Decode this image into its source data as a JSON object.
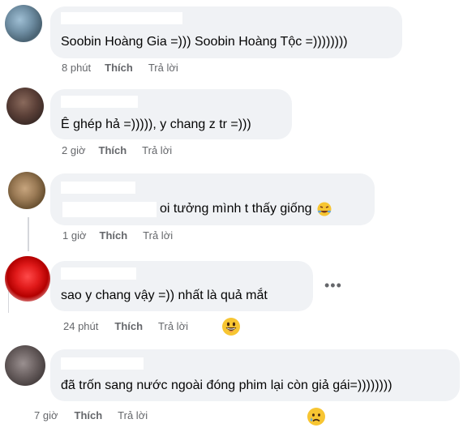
{
  "comments": [
    {
      "text": "Soobin Hoàng Gia =))) Soobin Hoàng Tộc =))))))))",
      "time": "8 phút",
      "like": "Thích",
      "reply": "Trả lời"
    },
    {
      "text": "Ê ghép hả =))))), y chang z tr =)))",
      "time": "2 giờ",
      "like": "Thích",
      "reply": "Trả lời"
    },
    {
      "text": "oi tưởng mình t thấy giống",
      "time": "1 giờ",
      "like": "Thích",
      "reply": "Trả lời",
      "emoji": "rofl-emoji"
    },
    {
      "text": "sao y chang vậy =)) nhất là quả mắt",
      "time": "24 phút",
      "like": "Thích",
      "reply": "Trả lời",
      "reaction": "grin-emoji"
    },
    {
      "text": "đã trốn sang nước ngoài đóng phim lại còn giả gái=))))))))",
      "time": "7 giờ",
      "like": "Thích",
      "reply": "Trả lời",
      "reaction": "sad-tear-emoji"
    }
  ],
  "more_label": "•••",
  "colors": {
    "bubble": "#f0f2f5",
    "meta": "#65676b",
    "text": "#050505"
  }
}
